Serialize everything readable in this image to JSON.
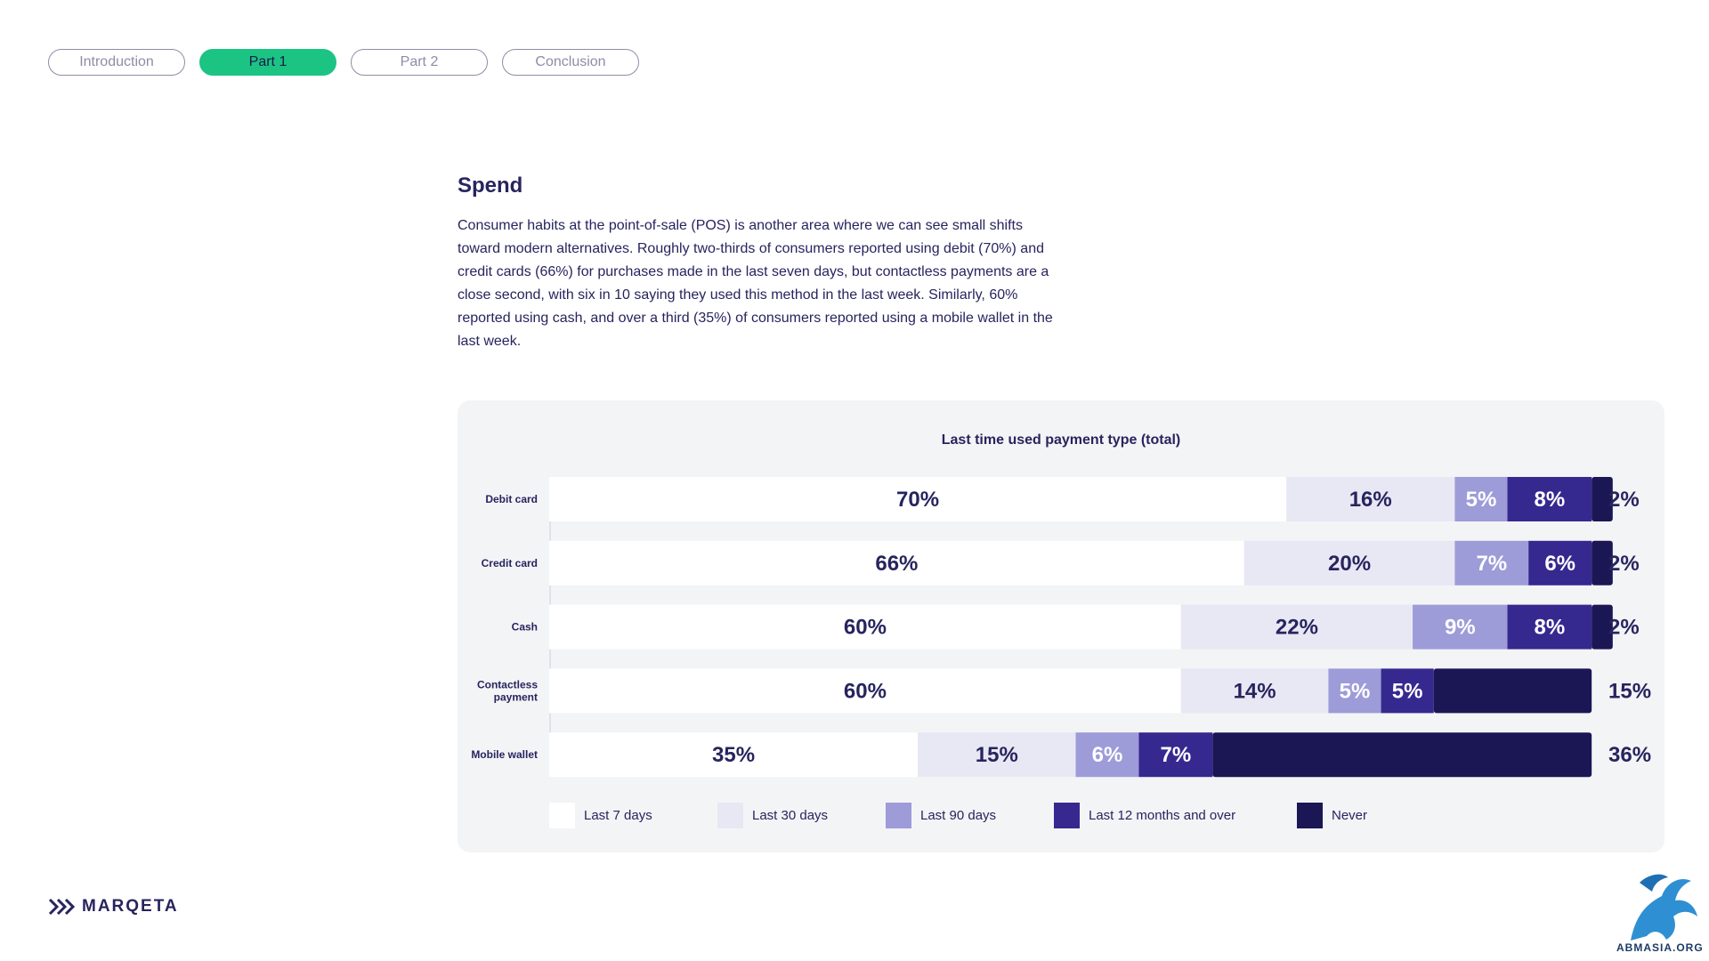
{
  "nav": {
    "tabs": [
      {
        "label": "Introduction",
        "active": false
      },
      {
        "label": "Part 1",
        "active": true
      },
      {
        "label": "Part 2",
        "active": false
      },
      {
        "label": "Conclusion",
        "active": false
      }
    ]
  },
  "article": {
    "heading": "Spend",
    "body": "Consumer habits at the point-of-sale (POS) is another area where we can see small shifts toward modern alternatives. Roughly two-thirds of consumers reported using debit (70%) and credit cards (66%) for purchases made in the last seven days, but contactless payments are a close second, with six in 10 saying they used this method in the last week. Similarly, 60% reported using cash, and over a third (35%) of consumers reported using a mobile wallet in the last week."
  },
  "chart_data": {
    "type": "bar",
    "orientation": "horizontal",
    "stacked": true,
    "title": "Last time used payment type (total)",
    "categories": [
      "Debit card",
      "Credit card",
      "Cash",
      "Contactless payment",
      "Mobile wallet"
    ],
    "series": [
      {
        "name": "Last 7 days",
        "color": "#ffffff",
        "label_color": "#27245e",
        "values": [
          70,
          66,
          60,
          60,
          35
        ]
      },
      {
        "name": "Last 30 days",
        "color": "#e8e8f4",
        "label_color": "#27245e",
        "values": [
          16,
          20,
          22,
          14,
          15
        ]
      },
      {
        "name": "Last 90 days",
        "color": "#9e9bd9",
        "label_color": "#ffffff",
        "values": [
          5,
          7,
          9,
          5,
          6
        ]
      },
      {
        "name": "Last 12 months and over",
        "color": "#35298f",
        "label_color": "#ffffff",
        "values": [
          8,
          6,
          8,
          5,
          7
        ]
      },
      {
        "name": "Never",
        "color": "#1b1654",
        "label_color": "#27245e",
        "values": [
          2,
          2,
          2,
          15,
          36
        ]
      }
    ],
    "xlim": [
      0,
      100
    ],
    "grid": false,
    "legend_position": "bottom"
  },
  "brand": {
    "logo_text": "MARQETA",
    "watermark_text": "ABMASIA.ORG"
  }
}
